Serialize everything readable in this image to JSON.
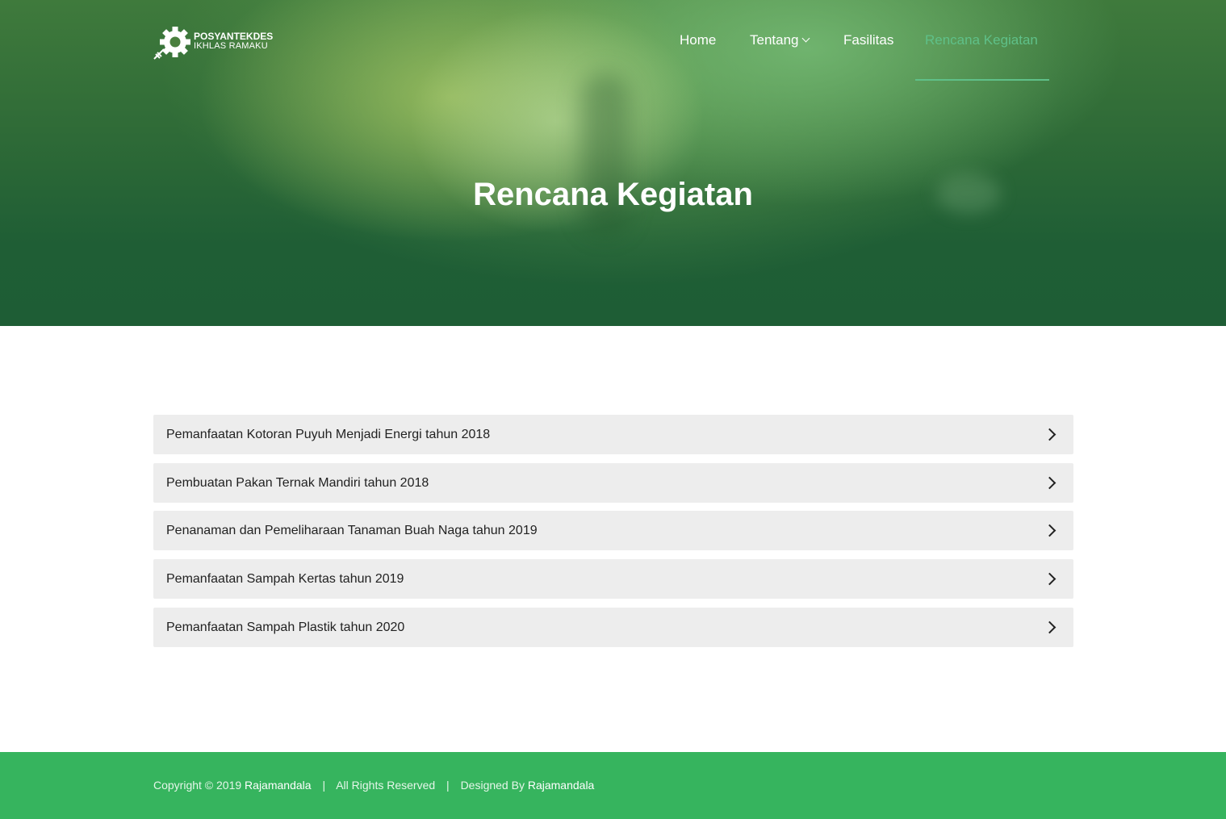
{
  "brand": {
    "line1": "POSYANTEKDES",
    "line2": "IKHLAS RAMAKU"
  },
  "nav": {
    "items": [
      {
        "label": "Home"
      },
      {
        "label": "Tentang"
      },
      {
        "label": "Fasilitas"
      },
      {
        "label": "Rencana Kegiatan"
      }
    ],
    "active": "Rencana Kegiatan"
  },
  "hero": {
    "title": "Rencana Kegiatan"
  },
  "activities": [
    {
      "label": "Pemanfaatan Kotoran Puyuh Menjadi Energi tahun 2018"
    },
    {
      "label": "Pembuatan Pakan Ternak Mandiri tahun 2018"
    },
    {
      "label": "Penanaman dan Pemeliharaan Tanaman Buah Naga tahun 2019"
    },
    {
      "label": "Pemanfaatan Sampah Kertas tahun 2019"
    },
    {
      "label": "Pemanfaatan Sampah Plastik tahun 2020"
    }
  ],
  "footer": {
    "copyright_prefix": "Copyright © 2019",
    "copyright_name": "Rajamandala",
    "separator": "|",
    "rights": "All Rights Reserved",
    "designed_prefix": "Designed By",
    "designed_name": "Rajamandala"
  },
  "colors": {
    "accent": "#5fc089",
    "footer_bg": "#36b45e",
    "item_bg": "#ededed"
  }
}
